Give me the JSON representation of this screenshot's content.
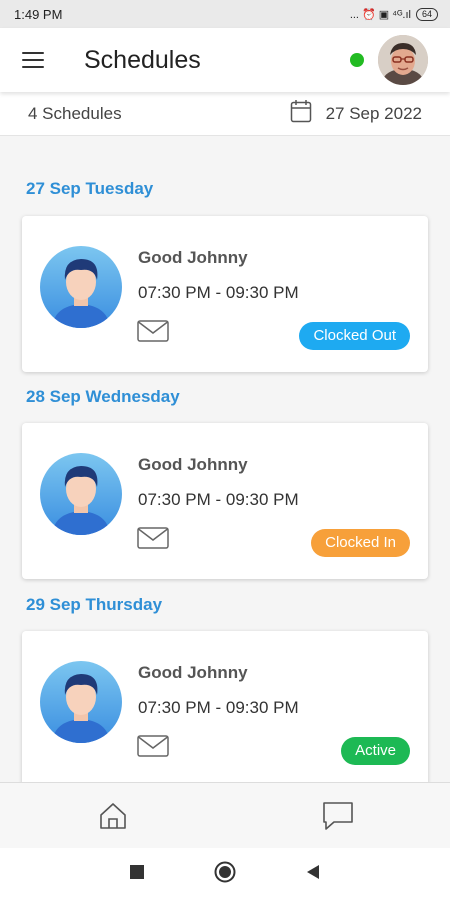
{
  "status_bar": {
    "time": "1:49 PM",
    "indicators": "... ⏰ ▣ ⁴ᴳ.ıl",
    "battery": "64"
  },
  "header": {
    "title": "Schedules",
    "online_color": "#22bb22"
  },
  "summary": {
    "count_label": "4 Schedules",
    "date_label": "27 Sep 2022"
  },
  "schedules": [
    {
      "day": "27 Sep Tuesday",
      "name": "Good Johnny",
      "time": "07:30 PM - 09:30 PM",
      "status": "Clocked Out",
      "status_color": "#1eaaf1"
    },
    {
      "day": "28 Sep Wednesday",
      "name": "Good Johnny",
      "time": "07:30 PM - 09:30 PM",
      "status": "Clocked In",
      "status_color": "#f7a03a"
    },
    {
      "day": "29 Sep Thursday",
      "name": "Good Johnny",
      "time": "07:30 PM - 09:30 PM",
      "status": "Active",
      "status_color": "#1db954"
    }
  ],
  "bottom_nav": {
    "items": [
      "home-icon",
      "chat-icon"
    ]
  },
  "accent_color": "#2f8fd6"
}
